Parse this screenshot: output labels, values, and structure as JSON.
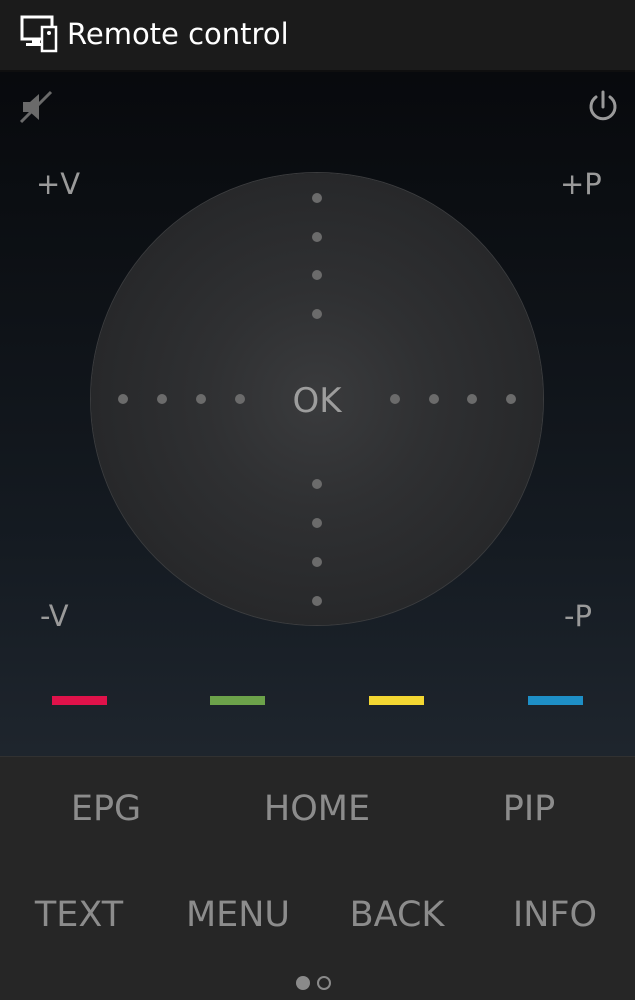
{
  "header": {
    "title": "Remote control",
    "icon": "remote-monitor-icon"
  },
  "top_controls": {
    "mute_icon": "mute-icon",
    "power_icon": "power-icon"
  },
  "labels": {
    "volume_up": "+V",
    "channel_up": "+P",
    "volume_down": "-V",
    "channel_down": "-P",
    "ok": "OK"
  },
  "color_keys": [
    {
      "name": "red",
      "color": "#e0124a"
    },
    {
      "name": "green",
      "color": "#6ca24a"
    },
    {
      "name": "yellow",
      "color": "#f3d732"
    },
    {
      "name": "blue",
      "color": "#1e8fc6"
    }
  ],
  "keys": {
    "row1": [
      "EPG",
      "HOME",
      "PIP"
    ],
    "row2": [
      "TEXT",
      "MENU",
      "BACK",
      "INFO"
    ]
  },
  "pager": {
    "pages": 2,
    "active": 1
  }
}
